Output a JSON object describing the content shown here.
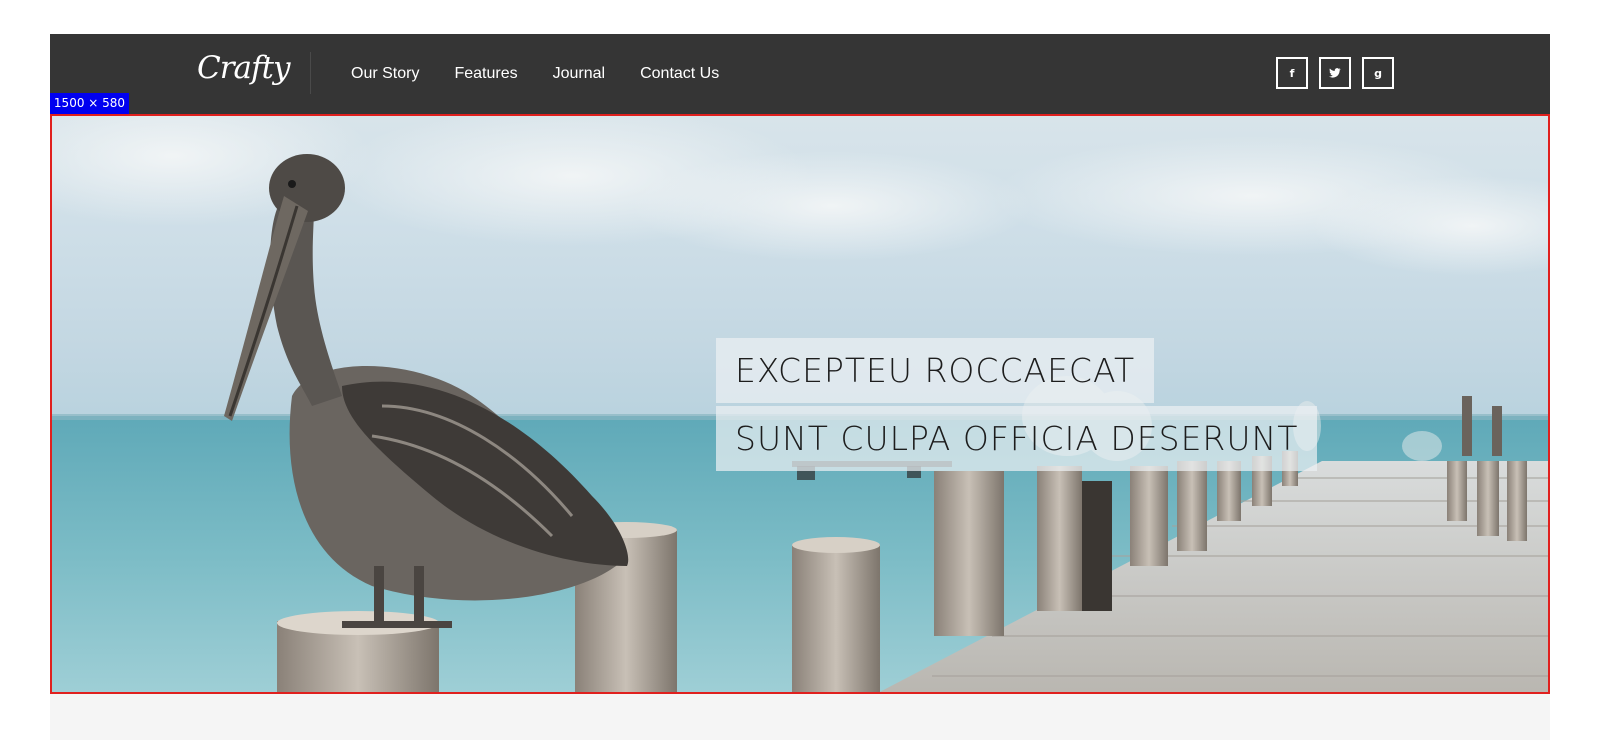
{
  "header": {
    "logo_text": "Crafty",
    "nav": [
      {
        "label": "Our Story"
      },
      {
        "label": "Features"
      },
      {
        "label": "Journal"
      },
      {
        "label": "Contact Us"
      }
    ],
    "social": [
      {
        "icon": "facebook-icon",
        "glyph": "f"
      },
      {
        "icon": "twitter-icon",
        "glyph": "🐦"
      },
      {
        "icon": "google-plus-icon",
        "glyph": "g"
      }
    ]
  },
  "dimension_badge": "1500 × 580",
  "hero": {
    "caption_line_1": "EXCEPTEU ROCCAECAT",
    "caption_line_2": "SUNT CULPA OFFICIA DESERUNT"
  },
  "colors": {
    "header_bg": "#353535",
    "hero_border": "#e0201e",
    "badge_bg": "#0000f0"
  }
}
